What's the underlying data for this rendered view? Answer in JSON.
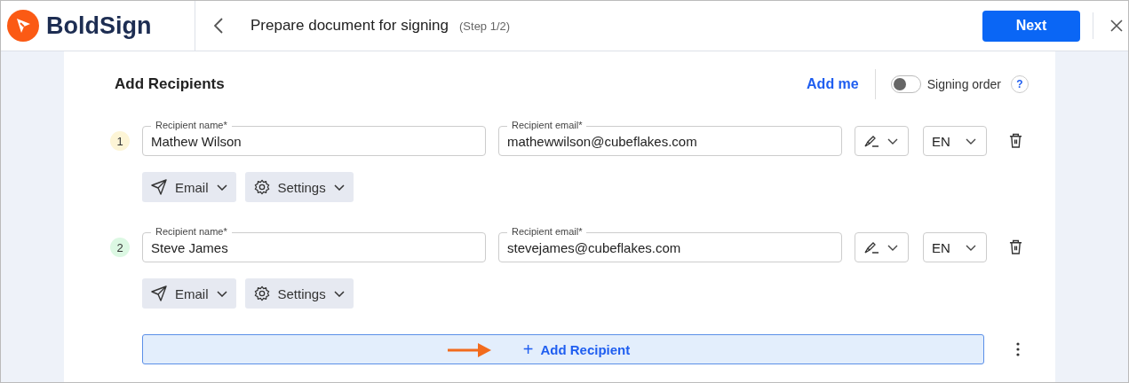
{
  "header": {
    "brand": "BoldSign",
    "title": "Prepare document for signing",
    "step": "(Step 1/2)",
    "next_button": "Next"
  },
  "card": {
    "title": "Add Recipients",
    "add_me": "Add me",
    "signing_order": {
      "label": "Signing order",
      "on": false,
      "help": "?"
    }
  },
  "recipients": [
    {
      "number": "1",
      "color": "#fdf5d6",
      "name_label": "Recipient name*",
      "name": "Mathew Wilson",
      "email_label": "Recipient email*",
      "email": "mathewwilson@cubeflakes.com",
      "language": "EN",
      "delivery": "Email",
      "settings": "Settings"
    },
    {
      "number": "2",
      "color": "#dcf8e3",
      "name_label": "Recipient name*",
      "name": "Steve James",
      "email_label": "Recipient email*",
      "email": "stevejames@cubeflakes.com",
      "language": "EN",
      "delivery": "Email",
      "settings": "Settings"
    }
  ],
  "add_recipient": {
    "icon": "+",
    "label": "Add Recipient"
  }
}
